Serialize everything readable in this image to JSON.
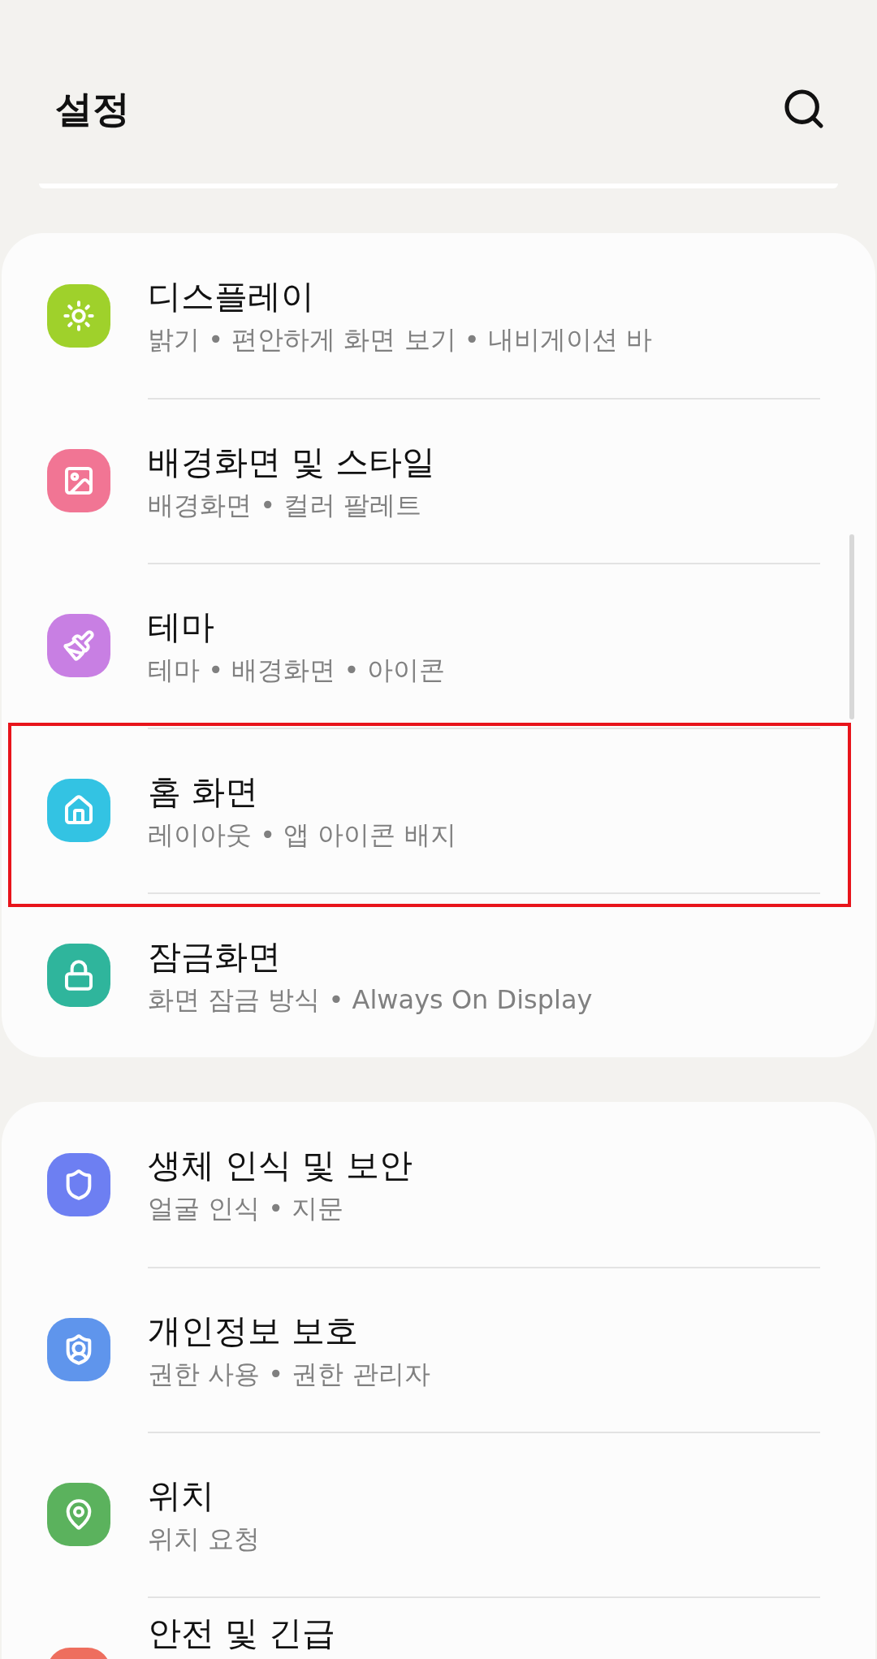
{
  "header": {
    "title": "설정"
  },
  "groups": [
    {
      "items": [
        {
          "title": "디스플레이",
          "subtitle": "밝기 • 편안하게 화면 보기 • 내비게이션 바",
          "color": "#9fd12b",
          "highlighted": false
        },
        {
          "title": "배경화면 및 스타일",
          "subtitle": "배경화면 • 컬러 팔레트",
          "color": "#f17594",
          "highlighted": false
        },
        {
          "title": "테마",
          "subtitle": "테마 • 배경화면 • 아이콘",
          "color": "#c87fe3",
          "highlighted": false
        },
        {
          "title": "홈 화면",
          "subtitle": "레이아웃 • 앱 아이콘 배지",
          "color": "#33c3e3",
          "highlighted": true
        },
        {
          "title": "잠금화면",
          "subtitle": "화면 잠금 방식 • Always On Display",
          "color": "#2fb59c",
          "highlighted": false
        }
      ]
    },
    {
      "items": [
        {
          "title": "생체 인식 및 보안",
          "subtitle": "얼굴 인식 • 지문",
          "color": "#6d7ff2",
          "highlighted": false
        },
        {
          "title": "개인정보 보호",
          "subtitle": "권한 사용 • 권한 관리자",
          "color": "#5f95ec",
          "highlighted": false
        },
        {
          "title": "위치",
          "subtitle": "위치 요청",
          "color": "#5bb25d",
          "highlighted": false
        },
        {
          "title": "안전 및 긴급",
          "color": "#ee6e5e",
          "highlighted": false
        }
      ]
    }
  ]
}
